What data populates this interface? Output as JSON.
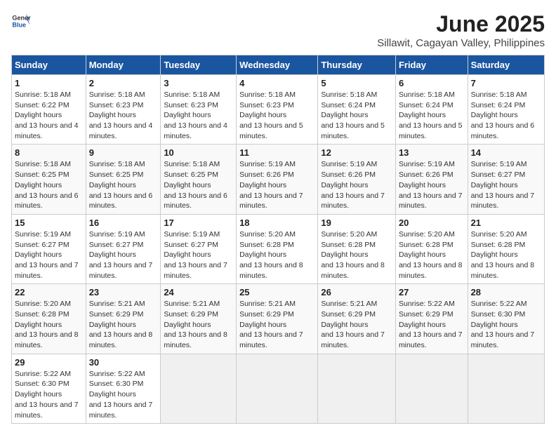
{
  "header": {
    "logo_general": "General",
    "logo_blue": "Blue",
    "title": "June 2025",
    "subtitle": "Sillawit, Cagayan Valley, Philippines"
  },
  "calendar": {
    "days_of_week": [
      "Sunday",
      "Monday",
      "Tuesday",
      "Wednesday",
      "Thursday",
      "Friday",
      "Saturday"
    ],
    "weeks": [
      [
        {
          "day": "",
          "empty": true
        },
        {
          "day": "",
          "empty": true
        },
        {
          "day": "",
          "empty": true
        },
        {
          "day": "",
          "empty": true
        },
        {
          "day": "",
          "empty": true
        },
        {
          "day": "",
          "empty": true
        },
        {
          "day": "",
          "empty": true
        }
      ],
      [
        {
          "day": "1",
          "sunrise": "5:18 AM",
          "sunset": "6:22 PM",
          "daylight": "13 hours and 4 minutes."
        },
        {
          "day": "2",
          "sunrise": "5:18 AM",
          "sunset": "6:23 PM",
          "daylight": "13 hours and 4 minutes."
        },
        {
          "day": "3",
          "sunrise": "5:18 AM",
          "sunset": "6:23 PM",
          "daylight": "13 hours and 4 minutes."
        },
        {
          "day": "4",
          "sunrise": "5:18 AM",
          "sunset": "6:23 PM",
          "daylight": "13 hours and 5 minutes."
        },
        {
          "day": "5",
          "sunrise": "5:18 AM",
          "sunset": "6:24 PM",
          "daylight": "13 hours and 5 minutes."
        },
        {
          "day": "6",
          "sunrise": "5:18 AM",
          "sunset": "6:24 PM",
          "daylight": "13 hours and 5 minutes."
        },
        {
          "day": "7",
          "sunrise": "5:18 AM",
          "sunset": "6:24 PM",
          "daylight": "13 hours and 6 minutes."
        }
      ],
      [
        {
          "day": "8",
          "sunrise": "5:18 AM",
          "sunset": "6:25 PM",
          "daylight": "13 hours and 6 minutes."
        },
        {
          "day": "9",
          "sunrise": "5:18 AM",
          "sunset": "6:25 PM",
          "daylight": "13 hours and 6 minutes."
        },
        {
          "day": "10",
          "sunrise": "5:18 AM",
          "sunset": "6:25 PM",
          "daylight": "13 hours and 6 minutes."
        },
        {
          "day": "11",
          "sunrise": "5:19 AM",
          "sunset": "6:26 PM",
          "daylight": "13 hours and 7 minutes."
        },
        {
          "day": "12",
          "sunrise": "5:19 AM",
          "sunset": "6:26 PM",
          "daylight": "13 hours and 7 minutes."
        },
        {
          "day": "13",
          "sunrise": "5:19 AM",
          "sunset": "6:26 PM",
          "daylight": "13 hours and 7 minutes."
        },
        {
          "day": "14",
          "sunrise": "5:19 AM",
          "sunset": "6:27 PM",
          "daylight": "13 hours and 7 minutes."
        }
      ],
      [
        {
          "day": "15",
          "sunrise": "5:19 AM",
          "sunset": "6:27 PM",
          "daylight": "13 hours and 7 minutes."
        },
        {
          "day": "16",
          "sunrise": "5:19 AM",
          "sunset": "6:27 PM",
          "daylight": "13 hours and 7 minutes."
        },
        {
          "day": "17",
          "sunrise": "5:19 AM",
          "sunset": "6:27 PM",
          "daylight": "13 hours and 7 minutes."
        },
        {
          "day": "18",
          "sunrise": "5:20 AM",
          "sunset": "6:28 PM",
          "daylight": "13 hours and 8 minutes."
        },
        {
          "day": "19",
          "sunrise": "5:20 AM",
          "sunset": "6:28 PM",
          "daylight": "13 hours and 8 minutes."
        },
        {
          "day": "20",
          "sunrise": "5:20 AM",
          "sunset": "6:28 PM",
          "daylight": "13 hours and 8 minutes."
        },
        {
          "day": "21",
          "sunrise": "5:20 AM",
          "sunset": "6:28 PM",
          "daylight": "13 hours and 8 minutes."
        }
      ],
      [
        {
          "day": "22",
          "sunrise": "5:20 AM",
          "sunset": "6:28 PM",
          "daylight": "13 hours and 8 minutes."
        },
        {
          "day": "23",
          "sunrise": "5:21 AM",
          "sunset": "6:29 PM",
          "daylight": "13 hours and 8 minutes."
        },
        {
          "day": "24",
          "sunrise": "5:21 AM",
          "sunset": "6:29 PM",
          "daylight": "13 hours and 8 minutes."
        },
        {
          "day": "25",
          "sunrise": "5:21 AM",
          "sunset": "6:29 PM",
          "daylight": "13 hours and 7 minutes."
        },
        {
          "day": "26",
          "sunrise": "5:21 AM",
          "sunset": "6:29 PM",
          "daylight": "13 hours and 7 minutes."
        },
        {
          "day": "27",
          "sunrise": "5:22 AM",
          "sunset": "6:29 PM",
          "daylight": "13 hours and 7 minutes."
        },
        {
          "day": "28",
          "sunrise": "5:22 AM",
          "sunset": "6:30 PM",
          "daylight": "13 hours and 7 minutes."
        }
      ],
      [
        {
          "day": "29",
          "sunrise": "5:22 AM",
          "sunset": "6:30 PM",
          "daylight": "13 hours and 7 minutes."
        },
        {
          "day": "30",
          "sunrise": "5:22 AM",
          "sunset": "6:30 PM",
          "daylight": "13 hours and 7 minutes."
        },
        {
          "day": "",
          "empty": true
        },
        {
          "day": "",
          "empty": true
        },
        {
          "day": "",
          "empty": true
        },
        {
          "day": "",
          "empty": true
        },
        {
          "day": "",
          "empty": true
        }
      ]
    ]
  }
}
